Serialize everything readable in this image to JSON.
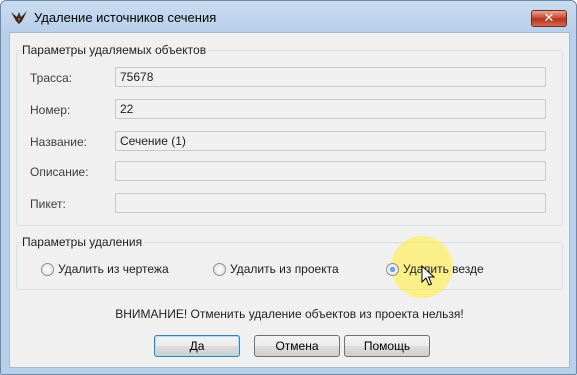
{
  "window": {
    "title": "Удаление источников сечения",
    "close_symbol": "✕",
    "icon": "app-bird-icon"
  },
  "object_params": {
    "legend": "Параметры удаляемых объектов",
    "fields": [
      {
        "label": "Трасса:",
        "value": "75678"
      },
      {
        "label": "Номер:",
        "value": "22"
      },
      {
        "label": "Название:",
        "value": "Сечение (1)"
      },
      {
        "label": "Описание:",
        "value": ""
      },
      {
        "label": "Пикет:",
        "value": ""
      }
    ]
  },
  "delete_params": {
    "legend": "Параметры удаления",
    "options": [
      {
        "label": "Удалить из чертежа",
        "selected": false
      },
      {
        "label": "Удалить из проекта",
        "selected": false
      },
      {
        "label": "Удалить везде",
        "selected": true
      }
    ]
  },
  "warning": "ВНИМАНИЕ! Отменить удаление объектов из проекта нельзя!",
  "buttons": {
    "ok": "Да",
    "cancel": "Отмена",
    "help": "Помощь"
  },
  "colors": {
    "title_bar": "#b9d0ea",
    "close_button": "#c7422a",
    "dialog_bg": "#f0f0f0",
    "cursor_highlight": "#ffee50"
  }
}
